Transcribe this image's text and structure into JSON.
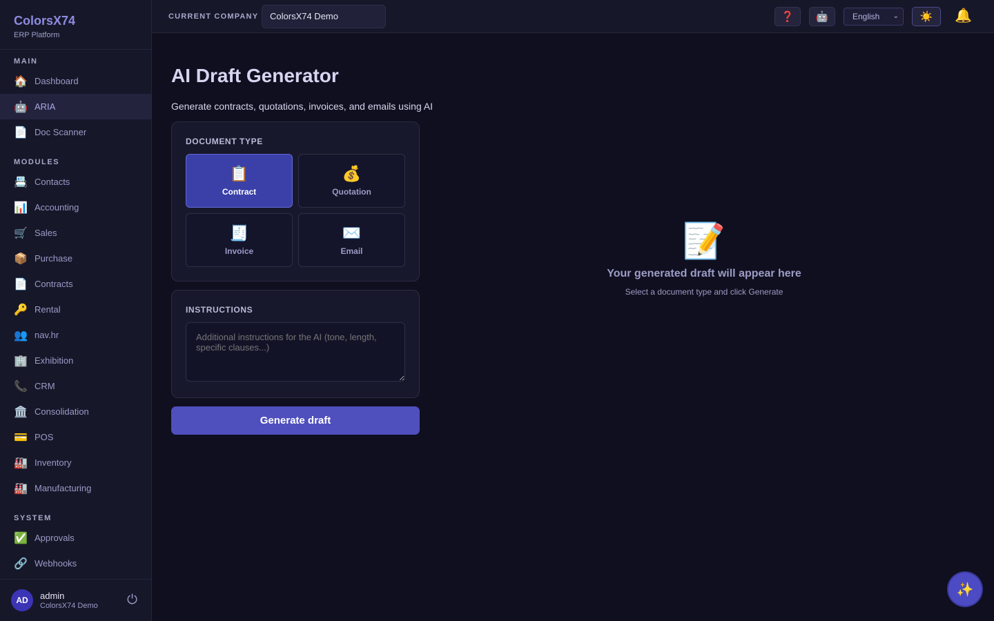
{
  "brand": {
    "name": "ColorsX74",
    "subtitle": "ERP Platform"
  },
  "sidebar": {
    "sections": [
      {
        "label": "MAIN",
        "items": [
          {
            "label": "Dashboard",
            "icon": "🏠",
            "icon_name": "home-icon"
          },
          {
            "label": "ARIA",
            "icon": "🤖",
            "icon_name": "robot-icon",
            "active": true
          },
          {
            "label": "Doc Scanner",
            "icon": "📄",
            "icon_name": "document-icon"
          }
        ]
      },
      {
        "label": "MODULES",
        "items": [
          {
            "label": "Contacts",
            "icon": "📇",
            "icon_name": "card-index-icon"
          },
          {
            "label": "Accounting",
            "icon": "📊",
            "icon_name": "bar-chart-icon"
          },
          {
            "label": "Sales",
            "icon": "🛒",
            "icon_name": "shopping-cart-icon"
          },
          {
            "label": "Purchase",
            "icon": "📦",
            "icon_name": "package-icon"
          },
          {
            "label": "Contracts",
            "icon": "📄",
            "icon_name": "document-icon"
          },
          {
            "label": "Rental",
            "icon": "🔑",
            "icon_name": "key-icon"
          },
          {
            "label": "nav.hr",
            "icon": "👥",
            "icon_name": "people-icon"
          },
          {
            "label": "Exhibition",
            "icon": "🏢",
            "icon_name": "office-building-icon"
          },
          {
            "label": "CRM",
            "icon": "📞",
            "icon_name": "phone-icon"
          },
          {
            "label": "Consolidation",
            "icon": "🏛️",
            "icon_name": "classical-building-icon"
          },
          {
            "label": "POS",
            "icon": "💳",
            "icon_name": "credit-card-icon"
          },
          {
            "label": "Inventory",
            "icon": "🏭",
            "icon_name": "factory-icon"
          },
          {
            "label": "Manufacturing",
            "icon": "🏭",
            "icon_name": "factory-icon"
          }
        ]
      },
      {
        "label": "SYSTEM",
        "items": [
          {
            "label": "Approvals",
            "icon": "✅",
            "icon_name": "check-mark-icon"
          },
          {
            "label": "Webhooks",
            "icon": "🔗",
            "icon_name": "link-icon"
          }
        ]
      }
    ],
    "user": {
      "initials": "AD",
      "name": "admin",
      "company": "ColorsX74 Demo",
      "logout_icon": "⏻"
    }
  },
  "topbar": {
    "company_label": "CURRENT COMPANY",
    "company_value": "ColorsX74 Demo",
    "help_icon": "❓",
    "assistant_icon": "🤖",
    "language": "English",
    "theme_icon": "☀️",
    "notification_icon": "🔔"
  },
  "main": {
    "title": "AI Draft Generator",
    "subtitle": "Generate contracts, quotations, invoices, and emails using AI",
    "document_type": {
      "label": "DOCUMENT TYPE",
      "options": [
        {
          "label": "Contract",
          "icon": "📋",
          "selected": true
        },
        {
          "label": "Quotation",
          "icon": "💰",
          "selected": false
        },
        {
          "label": "Invoice",
          "icon": "🧾",
          "selected": false
        },
        {
          "label": "Email",
          "icon": "✉️",
          "selected": false
        }
      ]
    },
    "instructions": {
      "label": "INSTRUCTIONS",
      "placeholder": "Additional instructions for the AI (tone, length, specific clauses...)",
      "value": ""
    },
    "generate_label": "Generate draft",
    "empty_state": {
      "icon": "📝",
      "title": "Your generated draft will appear here",
      "subtitle": "Select a document type and click Generate"
    }
  },
  "fab_icon": "✨",
  "colors": {
    "background": "#0f0f1f",
    "sidebar": "#17172a",
    "accent": "#4f4fbe",
    "selected_option": "#3a40a8",
    "brand": "#8d8ce0"
  }
}
